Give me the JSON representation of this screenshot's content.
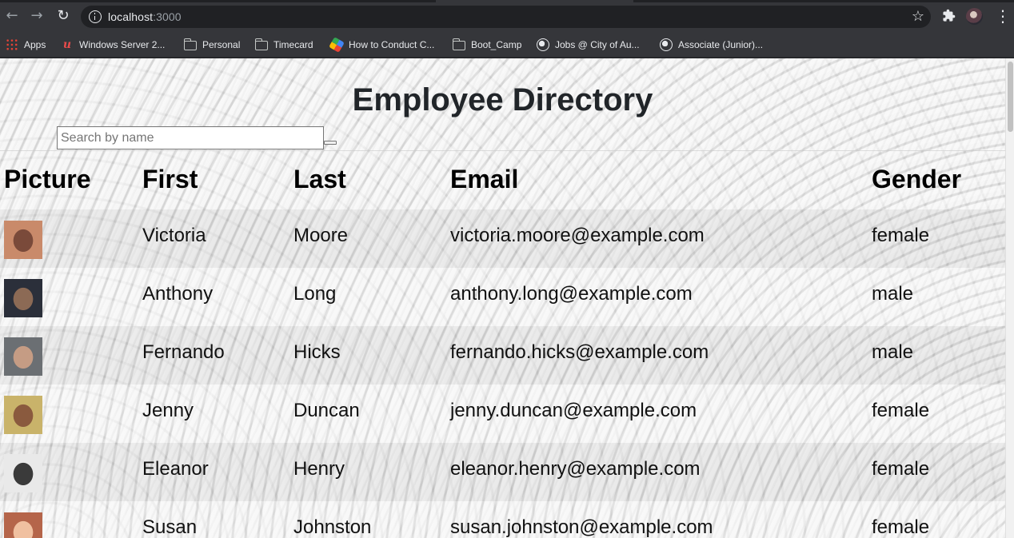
{
  "browser": {
    "url_host": "localhost",
    "url_port": ":3000",
    "bookmarks": [
      {
        "label": "Apps",
        "icon": "apps-grid-icon"
      },
      {
        "label": "Windows Server 2...",
        "icon": "windows-server-icon"
      },
      {
        "label": "Personal",
        "icon": "folder-icon"
      },
      {
        "label": "Timecard",
        "icon": "folder-icon"
      },
      {
        "label": "How to Conduct C...",
        "icon": "hexagon-icon"
      },
      {
        "label": "Boot_Camp",
        "icon": "folder-icon"
      },
      {
        "label": "Jobs @ City of Au...",
        "icon": "globe-icon"
      },
      {
        "label": "Associate (Junior)...",
        "icon": "globe-icon"
      }
    ]
  },
  "page": {
    "title": "Employee Directory",
    "search_placeholder": "Search by name",
    "search_value": ""
  },
  "table": {
    "headers": [
      "Picture",
      "First",
      "Last",
      "Email",
      "Gender"
    ],
    "rows": [
      {
        "first": "Victoria",
        "last": "Moore",
        "email": "victoria.moore@example.com",
        "gender": "female",
        "photo_colors": [
          "#c98a6a",
          "#7a4a3a"
        ]
      },
      {
        "first": "Anthony",
        "last": "Long",
        "email": "anthony.long@example.com",
        "gender": "male",
        "photo_colors": [
          "#2b2f3a",
          "#8c6a55"
        ]
      },
      {
        "first": "Fernando",
        "last": "Hicks",
        "email": "fernando.hicks@example.com",
        "gender": "male",
        "photo_colors": [
          "#6b6f73",
          "#c59c84"
        ]
      },
      {
        "first": "Jenny",
        "last": "Duncan",
        "email": "jenny.duncan@example.com",
        "gender": "female",
        "photo_colors": [
          "#c9b36a",
          "#8a5a3e"
        ]
      },
      {
        "first": "Eleanor",
        "last": "Henry",
        "email": "eleanor.henry@example.com",
        "gender": "female",
        "photo_colors": [
          "#e9e9e9",
          "#3a3a3a"
        ]
      },
      {
        "first": "Susan",
        "last": "Johnston",
        "email": "susan.johnston@example.com",
        "gender": "female",
        "photo_colors": [
          "#b5654a",
          "#f0c0a0"
        ]
      }
    ]
  }
}
